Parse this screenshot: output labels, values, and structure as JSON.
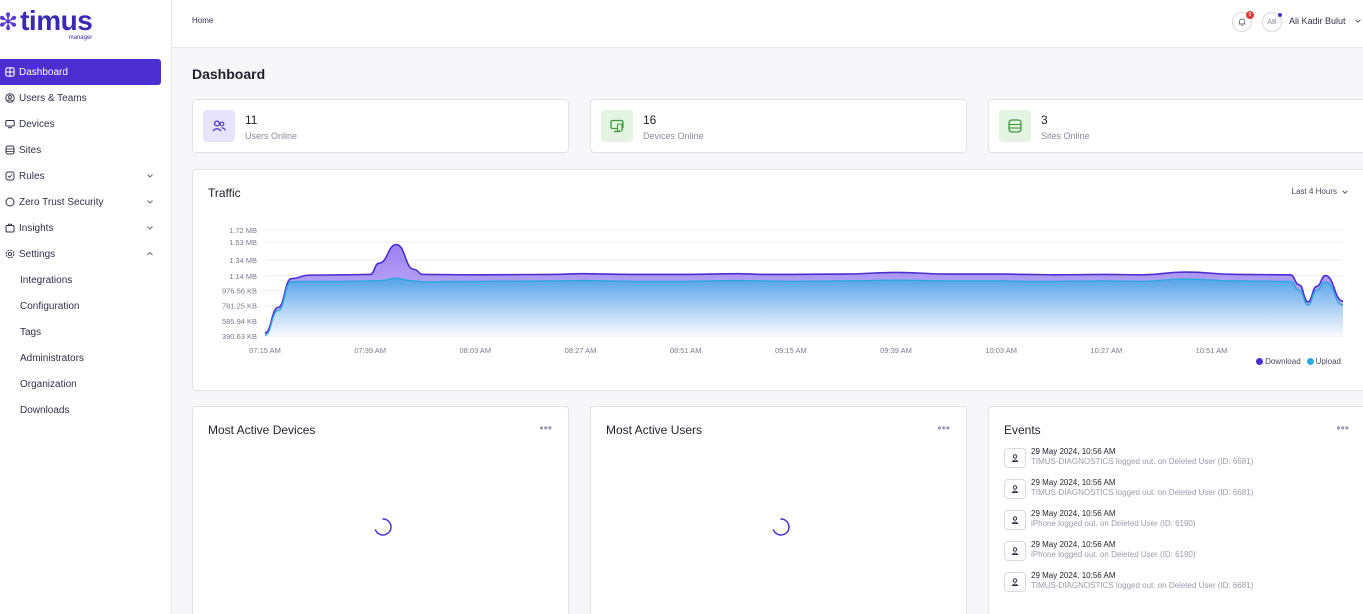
{
  "brand": {
    "name": "timus",
    "sub": "manager",
    "color": "#4b2fd1"
  },
  "sidebar": {
    "items": [
      {
        "label": "Dashboard",
        "icon": "dashboard-icon",
        "active": true
      },
      {
        "label": "Users & Teams",
        "icon": "users-icon"
      },
      {
        "label": "Devices",
        "icon": "devices-icon"
      },
      {
        "label": "Sites",
        "icon": "sites-icon"
      },
      {
        "label": "Rules",
        "icon": "rules-icon",
        "expandable": true
      },
      {
        "label": "Zero Trust Security",
        "icon": "zero-trust-icon",
        "expandable": true
      },
      {
        "label": "Insights",
        "icon": "insights-icon",
        "expandable": true
      },
      {
        "label": "Settings",
        "icon": "settings-icon",
        "expanded": true
      }
    ],
    "settings_sub": [
      "Integrations",
      "Configuration",
      "Tags",
      "Administrators",
      "Organization",
      "Downloads"
    ]
  },
  "topbar": {
    "breadcrumb": "Home",
    "notifications_count": "0",
    "avatar_initials": "AB",
    "user_name": "Ali Kadir Bulut"
  },
  "page_title": "Dashboard",
  "stats": [
    {
      "value": "11",
      "label": "Users Online",
      "icon": "users-icon",
      "bg": "#e6e3fb",
      "fg": "#4b2fd1"
    },
    {
      "value": "16",
      "label": "Devices Online",
      "icon": "devices-icon",
      "bg": "#e3f4e2",
      "fg": "#3f9a3c"
    },
    {
      "value": "3",
      "label": "Sites Online",
      "icon": "sites-icon",
      "bg": "#e3f4e2",
      "fg": "#3f9a3c"
    }
  ],
  "traffic": {
    "title": "Traffic",
    "range": "Last 4 Hours",
    "legend": [
      "Download",
      "Upload"
    ]
  },
  "chart_data": {
    "type": "area",
    "title": "Traffic",
    "x_ticks": [
      "07:15 AM",
      "07:39 AM",
      "08:03 AM",
      "08:27 AM",
      "08:51 AM",
      "09:15 AM",
      "09:39 AM",
      "10:03 AM",
      "10:27 AM",
      "10:51 AM"
    ],
    "y_ticks": [
      "390.63 KB",
      "585.94 KB",
      "781.25 KB",
      "976.56 KB",
      "1.14 MB",
      "1.34 MB",
      "1.53 MB",
      "1.72 MB"
    ],
    "y_range_kb": [
      390.63,
      1758.0
    ],
    "colors": {
      "download": "#4b2fd1",
      "upload": "#2ba8e0"
    },
    "series": [
      {
        "name": "Download",
        "x_min": [
          0,
          3,
          6,
          10,
          18,
          24,
          26,
          30,
          34,
          36,
          48,
          66,
          72,
          84,
          96,
          108,
          114,
          120,
          132,
          144,
          156,
          168,
          174,
          180,
          192,
          200,
          210,
          222,
          234,
          236,
          238,
          240,
          242,
          246
        ],
        "values_kb": [
          430,
          760,
          1130,
          1175,
          1180,
          1185,
          1330,
          1570,
          1250,
          1185,
          1180,
          1185,
          1195,
          1185,
          1185,
          1195,
          1185,
          1185,
          1190,
          1210,
          1190,
          1190,
          1185,
          1180,
          1185,
          1180,
          1215,
          1185,
          1180,
          1050,
          830,
          1030,
          1170,
          840
        ]
      },
      {
        "name": "Upload",
        "x_min": [
          0,
          3,
          6,
          10,
          18,
          24,
          26,
          30,
          34,
          36,
          48,
          66,
          72,
          84,
          96,
          108,
          114,
          120,
          132,
          144,
          156,
          168,
          174,
          180,
          192,
          200,
          210,
          222,
          234,
          236,
          238,
          240,
          242,
          246
        ],
        "values_kb": [
          400,
          720,
          1090,
          1095,
          1095,
          1100,
          1105,
          1135,
          1100,
          1090,
          1095,
          1100,
          1105,
          1095,
          1095,
          1105,
          1100,
          1095,
          1100,
          1110,
          1100,
          1100,
          1095,
          1095,
          1100,
          1095,
          1125,
          1100,
          1095,
          980,
          790,
          980,
          1090,
          790
        ]
      }
    ]
  },
  "most_active_devices": {
    "title": "Most Active Devices"
  },
  "most_active_users": {
    "title": "Most Active Users"
  },
  "events": {
    "title": "Events",
    "items": [
      {
        "time": "29 May 2024, 10:56 AM",
        "desc": "TIMUS-DIAGNOSTICS logged out. on Deleted User (ID: 6681)"
      },
      {
        "time": "29 May 2024, 10:56 AM",
        "desc": "TIMUS-DIAGNOSTICS logged out. on Deleted User (ID: 6681)"
      },
      {
        "time": "29 May 2024, 10:56 AM",
        "desc": "iPhone logged out. on Deleted User (ID: 6190)"
      },
      {
        "time": "29 May 2024, 10:56 AM",
        "desc": "iPhone logged out. on Deleted User (ID: 6190)"
      },
      {
        "time": "29 May 2024, 10:56 AM",
        "desc": "TIMUS-DIAGNOSTICS logged out. on Deleted User (ID: 6681)"
      }
    ]
  }
}
